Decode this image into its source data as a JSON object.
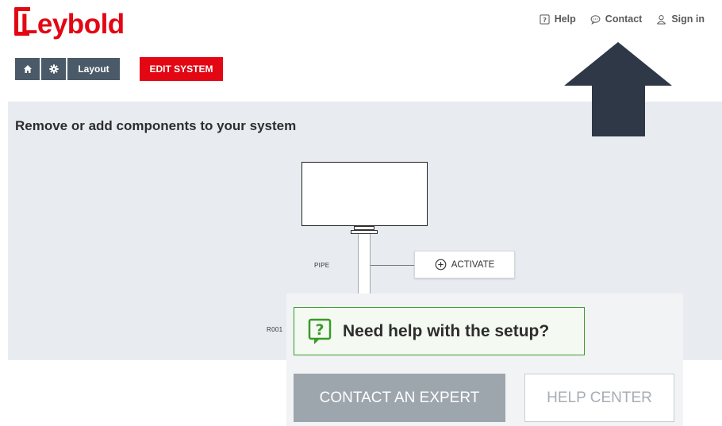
{
  "brand": {
    "name": "Leybold",
    "color": "#e30613"
  },
  "topnav": {
    "help": {
      "label": "Help",
      "icon": "help-square-icon"
    },
    "contact": {
      "label": "Contact",
      "icon": "chat-bubble-icon"
    },
    "signin": {
      "label": "Sign in",
      "icon": "user-icon"
    }
  },
  "toolbar": {
    "home_icon": "home-icon",
    "settings_icon": "gear-icon",
    "layout_label": "Layout",
    "edit_label": "EDIT SYSTEM"
  },
  "annotation": {
    "icon": "arrow-up-icon",
    "color": "#2e3846"
  },
  "panel": {
    "title": "Remove or add components to your system",
    "components": {
      "pipe_label": "PIPE",
      "activate_label": "ACTIVATE",
      "activate_icon": "plus-circle-icon",
      "r001_label": "R001"
    }
  },
  "help_popup": {
    "title": "Need help with the setup?",
    "icon": "help-square-icon",
    "contact_expert_label": "CONTACT AN EXPERT",
    "help_center_label": "HELP CENTER",
    "accent": "#3a9a2b"
  }
}
